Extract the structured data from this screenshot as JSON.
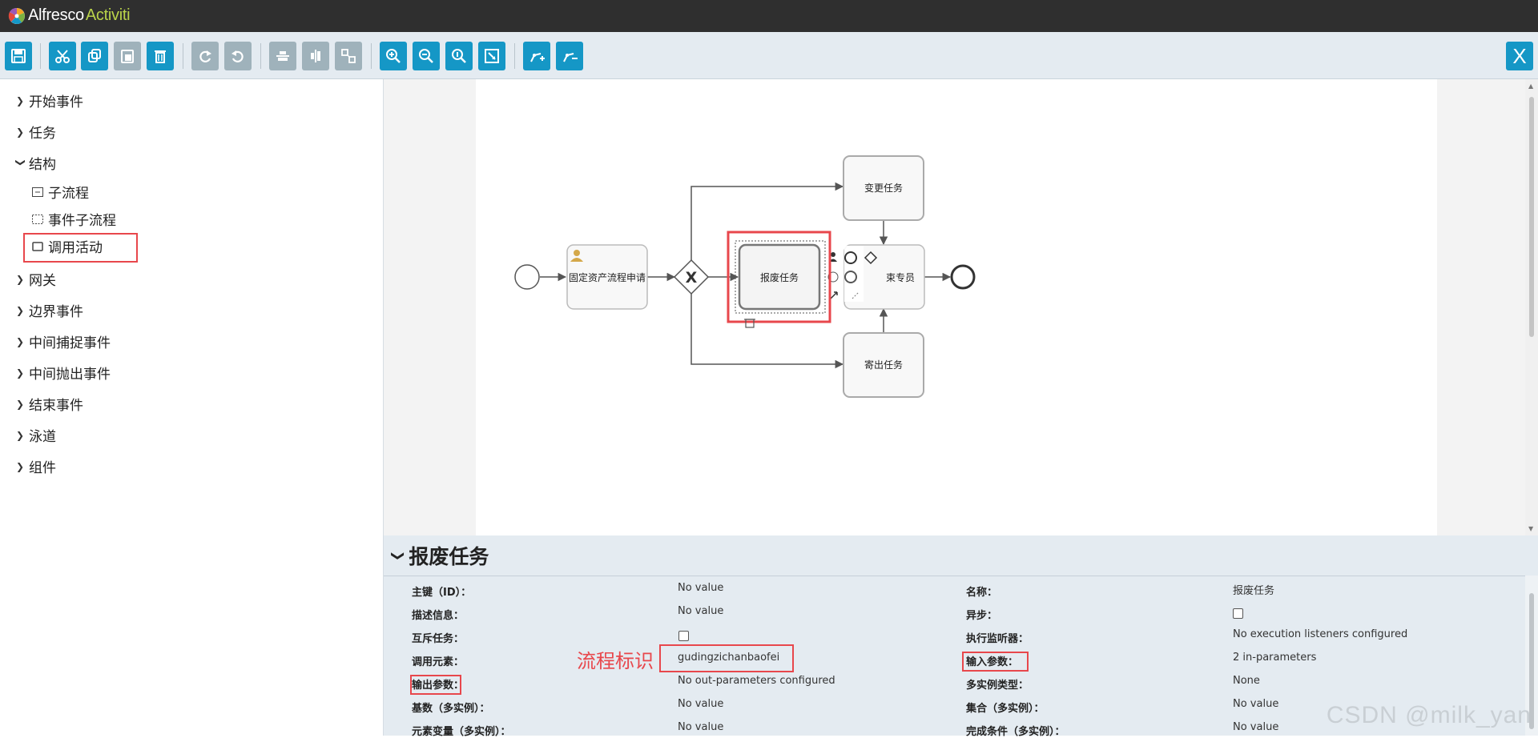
{
  "app": {
    "brand": "Alfresco",
    "product": "Activiti"
  },
  "toolbar": {
    "buttons": [
      "save-icon",
      "cut-icon",
      "copy-icon",
      "paste-icon",
      "delete-icon",
      "redo-icon",
      "undo-icon",
      "align-horizontal-icon",
      "align-vertical-icon",
      "same-size-icon",
      "zoom-in-icon",
      "zoom-out-icon",
      "zoom-actual-icon",
      "zoom-fit-icon",
      "add-bendpoint-icon",
      "remove-bendpoint-icon"
    ],
    "close_label": "X"
  },
  "palette": {
    "groups": [
      {
        "label": "开始事件",
        "expanded": false
      },
      {
        "label": "任务",
        "expanded": false
      },
      {
        "label": "结构",
        "expanded": true,
        "items": [
          "子流程",
          "事件子流程",
          "调用活动"
        ]
      },
      {
        "label": "网关",
        "expanded": false
      },
      {
        "label": "边界事件",
        "expanded": false
      },
      {
        "label": "中间捕捉事件",
        "expanded": false
      },
      {
        "label": "中间抛出事件",
        "expanded": false
      },
      {
        "label": "结束事件",
        "expanded": false
      },
      {
        "label": "泳道",
        "expanded": false
      },
      {
        "label": "组件",
        "expanded": false
      }
    ]
  },
  "diagram": {
    "tasks": {
      "apply": "固定资产流程申请",
      "change": "变更任务",
      "scrap": "报废任务",
      "specialist": "结束专员",
      "specialist_visible": "束专员",
      "loan": "寄出任务"
    },
    "gateway_mark": "X"
  },
  "properties": {
    "title": "报废任务",
    "left": [
      {
        "label": "主键（ID）：",
        "value": "No value"
      },
      {
        "label": "描述信息：",
        "value": "No value"
      },
      {
        "label": "互斥任务：",
        "value": "",
        "checkbox": true
      },
      {
        "label": "调用元素：",
        "value": "gudingzichanbaofei"
      },
      {
        "label": "输出参数：",
        "value": "No out-parameters configured"
      },
      {
        "label": "基数（多实例）：",
        "value": "No value"
      },
      {
        "label": "元素变量（多实例）：",
        "value": "No value"
      }
    ],
    "right": [
      {
        "label": "名称：",
        "value": "报废任务"
      },
      {
        "label": "异步：",
        "value": "",
        "checkbox": true
      },
      {
        "label": "执行监听器：",
        "value": "No execution listeners configured"
      },
      {
        "label": "输入参数：",
        "value": "2 in-parameters"
      },
      {
        "label": "多实例类型：",
        "value": "None"
      },
      {
        "label": "集合（多实例）：",
        "value": "No value"
      },
      {
        "label": "完成条件（多实例）：",
        "value": "No value"
      }
    ]
  },
  "annotation": "流程标识",
  "watermark": "CSDN @milk_yan",
  "colors": {
    "accent": "#1597c6",
    "highlight": "#e8474c",
    "topbar": "#2f2f2f"
  }
}
